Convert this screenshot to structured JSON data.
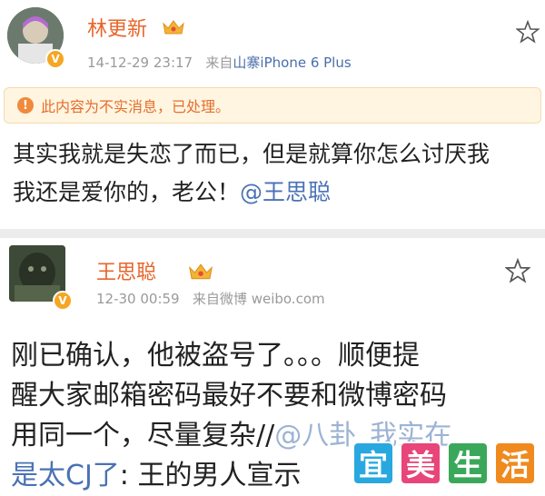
{
  "post1": {
    "username": "林更新",
    "time": "14-12-29 23:17",
    "source_prefix": "来自",
    "source": "山寨iPhone 6 Plus",
    "notice": "此内容为不实消息，已处理。",
    "line1": "其实我就是失恋了而已，但是就算你怎么讨厌我",
    "line2": "我还是爱你的，老公！",
    "mention": "@王思聪"
  },
  "post2": {
    "username": "王思聪",
    "time": "12-30 00:59",
    "source_prefix": "来自微博",
    "source": "weibo.com",
    "line1": "刚已确认，他被盗号了。。。顺便提",
    "line2": "醒大家邮箱密码最好不要和微博密码",
    "line3": "用同一个，尽量复杂//",
    "line3_mention": "@八卦_我实在",
    "line4_mention": "是太CJ了",
    "line4_text": ": 王的男人宣示"
  },
  "watermark": {
    "chars": [
      "宜",
      "美",
      "生",
      "活"
    ],
    "colors": [
      "#29a8e0",
      "#e8457a",
      "#3aa85a",
      "#f08a1e"
    ]
  },
  "icons": {
    "star": "star-outline-icon",
    "crown": "crown-icon",
    "verified": "verified-v-icon",
    "warning": "warning-icon"
  }
}
